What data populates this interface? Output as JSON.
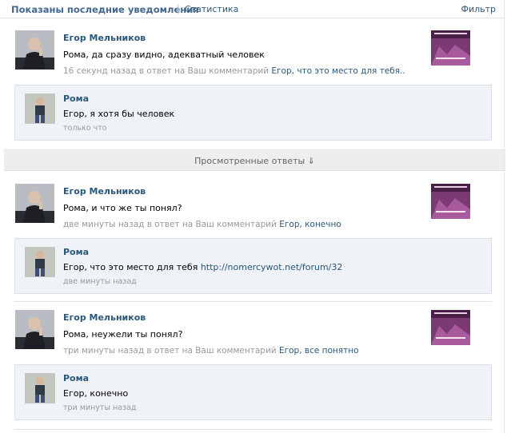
{
  "header": {
    "title": "Показаны последние уведомления",
    "separator": "|",
    "stats_link": "Статистика",
    "filter_link": "Фильтр"
  },
  "viewed_divider": "Просмотренные ответы ⇓",
  "notifications": [
    {
      "author": "Егор Мельников",
      "text": "Рома, да сразу видно, адекватный человек",
      "meta_prefix": "16 секунд назад в ответ на Ваш комментарий",
      "meta_link": "Егор, что это место для тебя..",
      "reply": {
        "author": "Рома",
        "text": "Егор, я хотя бы человек",
        "time": "только что"
      }
    },
    {
      "author": "Егор Мельников",
      "text": "Рома, и что же ты понял?",
      "meta_prefix": "две минуты назад в ответ на Ваш комментарий",
      "meta_link": "Егор, конечно",
      "reply": {
        "author": "Рома",
        "text_prefix": "Егор, что это место для тебя",
        "text_link": "http://nomercywot.net/forum/32",
        "time": "две минуты назад"
      }
    },
    {
      "author": "Егор Мельников",
      "text": "Рома, неужели ты понял?",
      "meta_prefix": "три минуты назад в ответ на Ваш комментарий",
      "meta_link": "Егор, все понятно",
      "reply": {
        "author": "Рома",
        "text": "Егор, конечно",
        "time": "три минуты назад"
      }
    }
  ],
  "colors": {
    "link": "#2b587a",
    "header_title": "#45688e",
    "reply_bg": "#eff2f6",
    "meta": "#999999"
  }
}
